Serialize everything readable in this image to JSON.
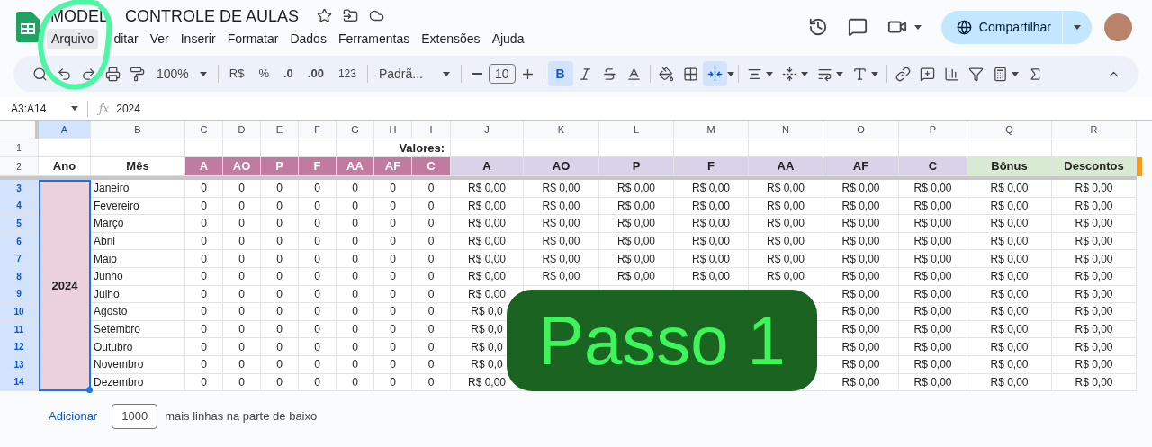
{
  "app": {
    "title_start": "MODEL",
    "title_end": "CONTROLE DE AULAS",
    "share_label": "Compartilhar"
  },
  "menu": [
    {
      "label": "Arquivo",
      "selected": true
    },
    {
      "label": "ditar",
      "selected": false
    },
    {
      "label": "Ver",
      "selected": false
    },
    {
      "label": "Inserir",
      "selected": false
    },
    {
      "label": "Formatar",
      "selected": false
    },
    {
      "label": "Dados",
      "selected": false
    },
    {
      "label": "Ferramentas",
      "selected": false
    },
    {
      "label": "Extensões",
      "selected": false
    },
    {
      "label": "Ajuda",
      "selected": false
    }
  ],
  "toolbar": {
    "zoom": "100%",
    "currency": "R$",
    "percent": "%",
    "decimal_less": ".0",
    "decimal_more": ".00",
    "number_format": "123",
    "font": "Padrã...",
    "font_size": "10",
    "bold": {
      "label": "B",
      "selected": true
    },
    "merge_selected": true
  },
  "formula_bar": {
    "range": "A3:A14",
    "fx_label": "ƒx",
    "formula": "2024"
  },
  "columns": [
    {
      "label": "A",
      "selected": true
    },
    {
      "label": "B",
      "selected": false
    },
    {
      "label": "C",
      "selected": false
    },
    {
      "label": "D",
      "selected": false
    },
    {
      "label": "E",
      "selected": false
    },
    {
      "label": "F",
      "selected": false
    },
    {
      "label": "G",
      "selected": false
    },
    {
      "label": "H",
      "selected": false
    },
    {
      "label": "I",
      "selected": false
    },
    {
      "label": "J",
      "selected": false
    },
    {
      "label": "K",
      "selected": false
    },
    {
      "label": "L",
      "selected": false
    },
    {
      "label": "M",
      "selected": false
    },
    {
      "label": "N",
      "selected": false
    },
    {
      "label": "O",
      "selected": false
    },
    {
      "label": "P",
      "selected": false
    },
    {
      "label": "Q",
      "selected": false
    },
    {
      "label": "R",
      "selected": false
    }
  ],
  "row_1": {
    "number": "1",
    "title": "Valores:"
  },
  "row_2": {
    "number": "2",
    "year_header": "Ano",
    "month_header": "Mês",
    "headers": [
      {
        "label": "A",
        "kind": "count"
      },
      {
        "label": "AO",
        "kind": "count"
      },
      {
        "label": "P",
        "kind": "count"
      },
      {
        "label": "F",
        "kind": "count"
      },
      {
        "label": "AA",
        "kind": "count"
      },
      {
        "label": "AF",
        "kind": "count"
      },
      {
        "label": "C",
        "kind": "count"
      },
      {
        "label": "A",
        "kind": "value"
      },
      {
        "label": "AO",
        "kind": "value"
      },
      {
        "label": "P",
        "kind": "value"
      },
      {
        "label": "F",
        "kind": "value"
      },
      {
        "label": "AA",
        "kind": "value"
      },
      {
        "label": "AF",
        "kind": "value"
      },
      {
        "label": "C",
        "kind": "value"
      },
      {
        "label": "Bônus",
        "kind": "extra"
      },
      {
        "label": "Descontos",
        "kind": "extra"
      }
    ]
  },
  "year": "2024",
  "rows": [
    {
      "number": "3",
      "selected": true,
      "month": "Janeiro",
      "cells": [
        "0",
        "0",
        "0",
        "0",
        "0",
        "0",
        "0",
        "R$ 0,00",
        "R$ 0,00",
        "R$ 0,00",
        "R$ 0,00",
        "R$ 0,00",
        "R$ 0,00",
        "R$ 0,00",
        "R$ 0,00",
        "R$ 0,00"
      ]
    },
    {
      "number": "4",
      "selected": true,
      "month": "Fevereiro",
      "cells": [
        "0",
        "0",
        "0",
        "0",
        "0",
        "0",
        "0",
        "R$ 0,00",
        "R$ 0,00",
        "R$ 0,00",
        "R$ 0,00",
        "R$ 0,00",
        "R$ 0,00",
        "R$ 0,00",
        "R$ 0,00",
        "R$ 0,00"
      ]
    },
    {
      "number": "5",
      "selected": true,
      "month": "Março",
      "cells": [
        "0",
        "0",
        "0",
        "0",
        "0",
        "0",
        "0",
        "R$ 0,00",
        "R$ 0,00",
        "R$ 0,00",
        "R$ 0,00",
        "R$ 0,00",
        "R$ 0,00",
        "R$ 0,00",
        "R$ 0,00",
        "R$ 0,00"
      ]
    },
    {
      "number": "6",
      "selected": true,
      "month": "Abril",
      "cells": [
        "0",
        "0",
        "0",
        "0",
        "0",
        "0",
        "0",
        "R$ 0,00",
        "R$ 0,00",
        "R$ 0,00",
        "R$ 0,00",
        "R$ 0,00",
        "R$ 0,00",
        "R$ 0,00",
        "R$ 0,00",
        "R$ 0,00"
      ]
    },
    {
      "number": "7",
      "selected": true,
      "month": "Maio",
      "cells": [
        "0",
        "0",
        "0",
        "0",
        "0",
        "0",
        "0",
        "R$ 0,00",
        "R$ 0,00",
        "R$ 0,00",
        "R$ 0,00",
        "R$ 0,00",
        "R$ 0,00",
        "R$ 0,00",
        "R$ 0,00",
        "R$ 0,00"
      ]
    },
    {
      "number": "8",
      "selected": true,
      "month": "Junho",
      "cells": [
        "0",
        "0",
        "0",
        "0",
        "0",
        "0",
        "0",
        "R$ 0,00",
        "R$ 0,00",
        "R$ 0,00",
        "R$ 0,00",
        "R$ 0,00",
        "R$ 0,00",
        "R$ 0,00",
        "R$ 0,00",
        "R$ 0,00"
      ]
    },
    {
      "number": "9",
      "selected": true,
      "month": "Julho",
      "cells": [
        "0",
        "0",
        "0",
        "0",
        "0",
        "0",
        "0",
        "R$ 0,00",
        null,
        null,
        null,
        null,
        "R$ 0,00",
        "R$ 0,00",
        "R$ 0,00",
        "R$ 0,00"
      ]
    },
    {
      "number": "10",
      "selected": true,
      "month": "Agosto",
      "cells": [
        "0",
        "0",
        "0",
        "0",
        "0",
        "0",
        "0",
        "R$ 0,0",
        null,
        null,
        null,
        null,
        "R$ 0,00",
        "R$ 0,00",
        "R$ 0,00",
        "R$ 0,00"
      ]
    },
    {
      "number": "11",
      "selected": true,
      "month": "Setembro",
      "cells": [
        "0",
        "0",
        "0",
        "0",
        "0",
        "0",
        "0",
        "R$ 0,0",
        null,
        null,
        null,
        null,
        "R$ 0,00",
        "R$ 0,00",
        "R$ 0,00",
        "R$ 0,00"
      ]
    },
    {
      "number": "12",
      "selected": true,
      "month": "Outubro",
      "cells": [
        "0",
        "0",
        "0",
        "0",
        "0",
        "0",
        "0",
        "R$ 0,0",
        null,
        null,
        null,
        null,
        "R$ 0,00",
        "R$ 0,00",
        "R$ 0,00",
        "R$ 0,00"
      ]
    },
    {
      "number": "13",
      "selected": true,
      "month": "Novembro",
      "cells": [
        "0",
        "0",
        "0",
        "0",
        "0",
        "0",
        "0",
        "R$ 0,0",
        null,
        null,
        null,
        null,
        "R$ 0,00",
        "R$ 0,00",
        "R$ 0,00",
        "R$ 0,00"
      ]
    },
    {
      "number": "14",
      "selected": true,
      "month": "Dezembro",
      "cells": [
        "0",
        "0",
        "0",
        "0",
        "0",
        "0",
        "0",
        "R$ 0,00",
        null,
        null,
        null,
        null,
        "R$ 0,00",
        "R$ 0,00",
        "R$ 0,00",
        "R$ 0,00"
      ]
    }
  ],
  "footer": {
    "add_label": "Adicionar",
    "row_count": "1000",
    "suffix": "mais linhas na parte de baixo"
  },
  "overlay": {
    "label": "Passo 1"
  }
}
